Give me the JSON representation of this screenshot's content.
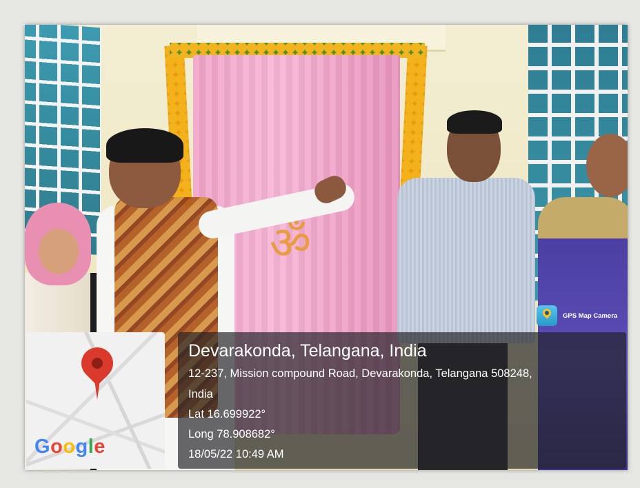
{
  "overlay": {
    "app_badge": "GPS Map Camera",
    "location_title": "Devarakonda, Telangana, India",
    "address_line1": "12-237, Mission compound Road, Devarakonda, Telangana 508248,",
    "address_line2": "India",
    "latitude": "Lat 16.699922°",
    "longitude": "Long 78.908682°",
    "datetime": "18/05/22 10:49 AM"
  },
  "map": {
    "logo_letters": [
      "G",
      "o",
      "o",
      "g",
      "l",
      "e"
    ],
    "logo_colors": [
      "#4285F4",
      "#EA4335",
      "#FBBC05",
      "#4285F4",
      "#34A853",
      "#EA4335"
    ],
    "pin_icon": "map-pin-icon"
  },
  "photo": {
    "cloth_symbol": "ॐ"
  }
}
